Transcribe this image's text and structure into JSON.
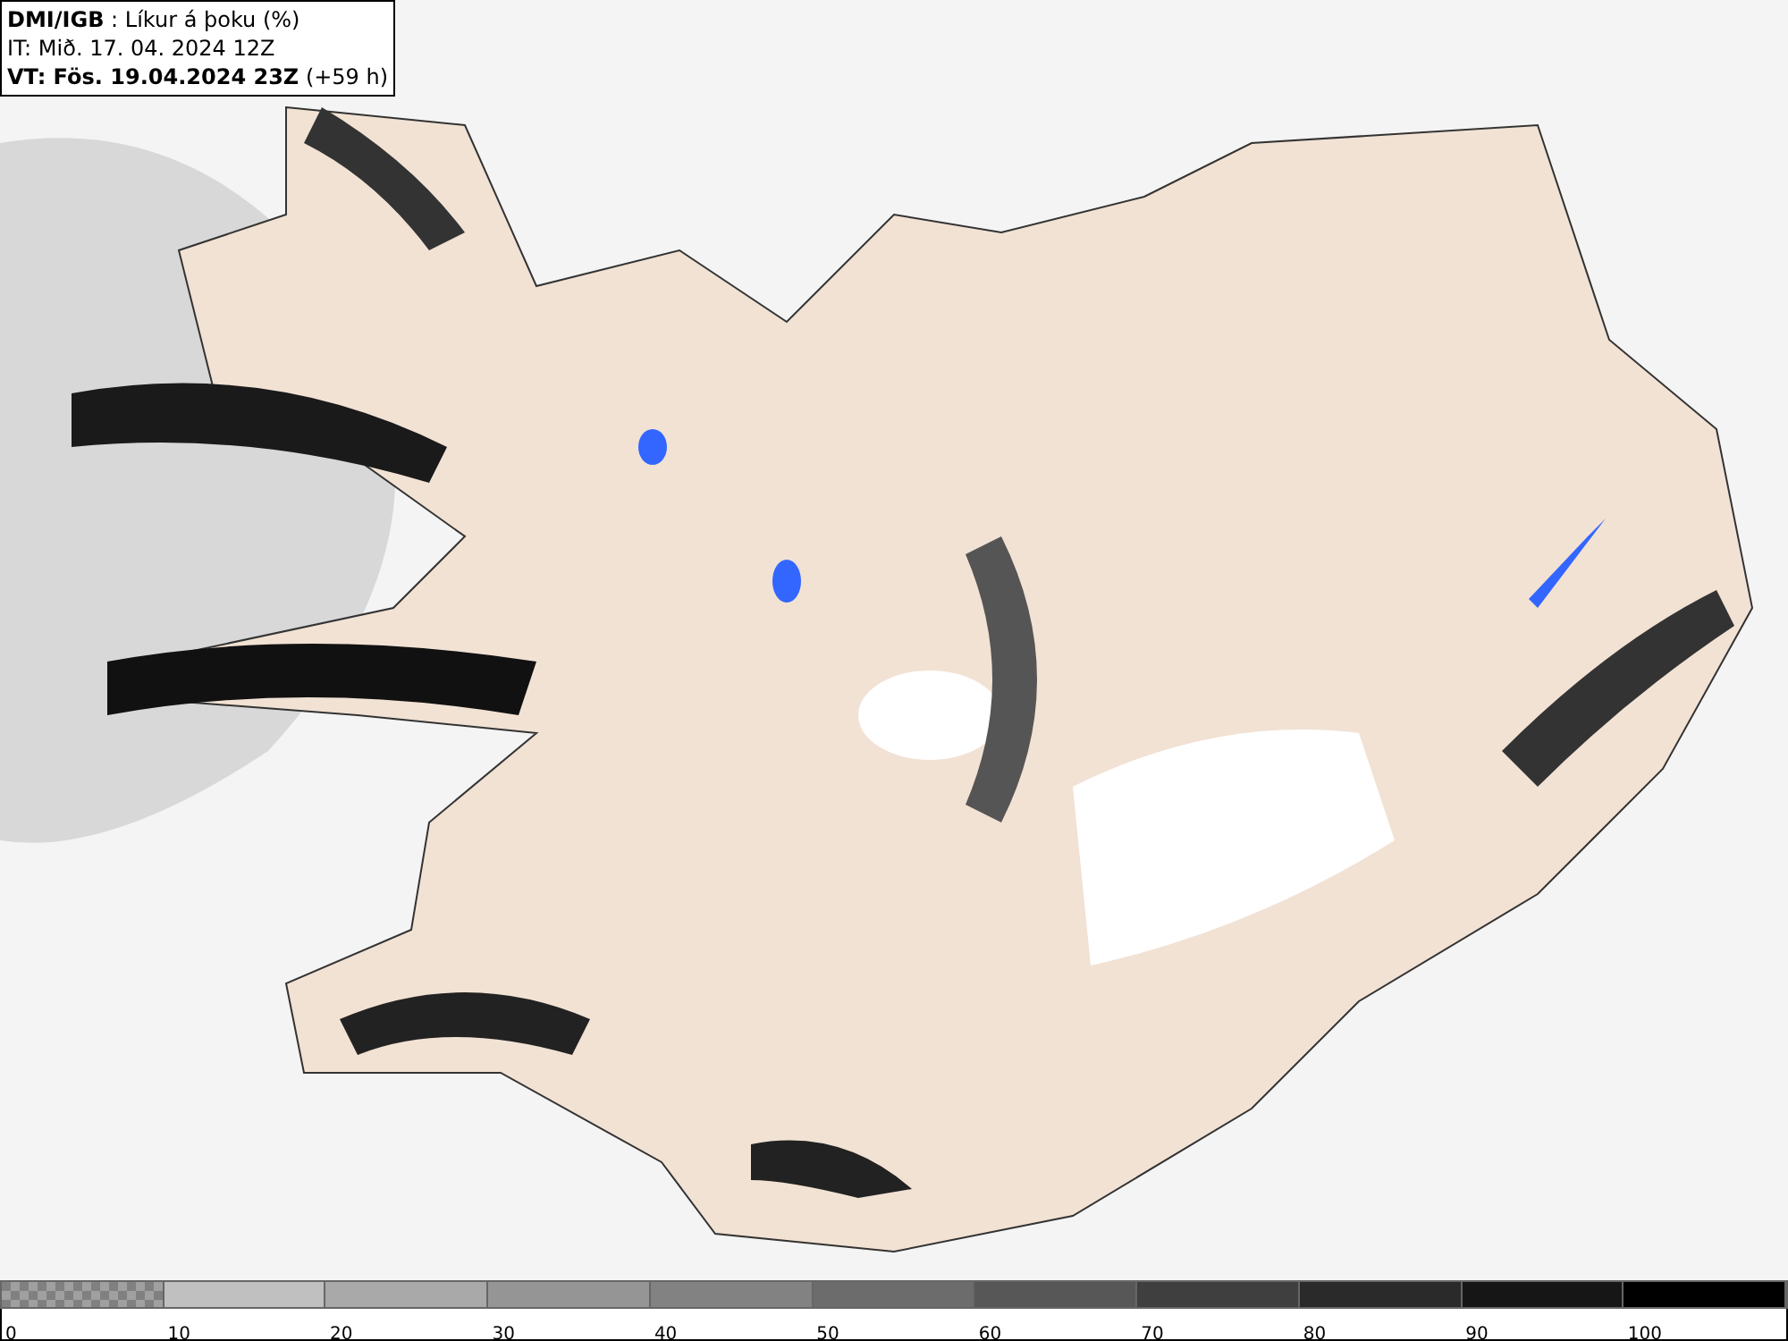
{
  "header": {
    "lines": [
      "**DMI/IGB** : Líkur á þoku (%)",
      "IT: Mið. 17. 04. 2024 12Z",
      "**VT: Fös. 19.04.2024 23Z** (+59 h)"
    ]
  },
  "legend": {
    "segments": [
      {
        "kind": "checker",
        "color": "#808080"
      },
      {
        "kind": "solid",
        "color": "#c0c0c0"
      },
      {
        "kind": "solid",
        "color": "#a9a9a9"
      },
      {
        "kind": "solid",
        "color": "#959595"
      },
      {
        "kind": "solid",
        "color": "#828282"
      },
      {
        "kind": "solid",
        "color": "#6c6c6c"
      },
      {
        "kind": "solid",
        "color": "#575757"
      },
      {
        "kind": "solid",
        "color": "#3f3f3f"
      },
      {
        "kind": "solid",
        "color": "#2a2a2a"
      },
      {
        "kind": "solid",
        "color": "#161616"
      },
      {
        "kind": "solid",
        "color": "#000000"
      }
    ],
    "labels": [
      "0",
      "10",
      "20",
      "30",
      "40",
      "50",
      "60",
      "70",
      "80",
      "90",
      "100"
    ]
  }
}
